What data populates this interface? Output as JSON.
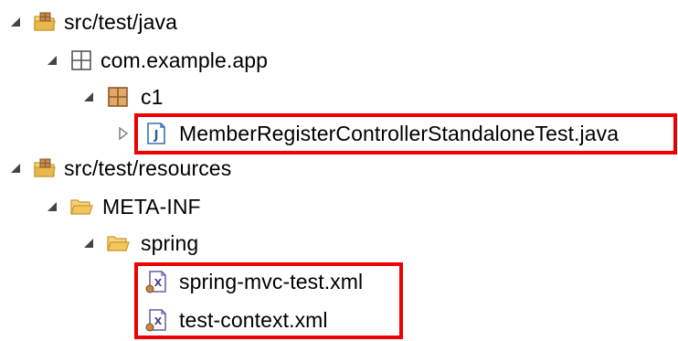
{
  "tree": {
    "items": [
      {
        "label": "src/test/java",
        "icon": "source-folder-icon",
        "state": "expanded"
      },
      {
        "label": "com.example.app",
        "icon": "package-empty-icon",
        "state": "expanded"
      },
      {
        "label": "c1",
        "icon": "package-icon",
        "state": "expanded"
      },
      {
        "label": "MemberRegisterControllerStandaloneTest.java",
        "icon": "java-file-icon",
        "state": "collapsed"
      },
      {
        "label": "src/test/resources",
        "icon": "source-folder-icon",
        "state": "expanded"
      },
      {
        "label": "META-INF",
        "icon": "folder-icon",
        "state": "expanded"
      },
      {
        "label": "spring",
        "icon": "folder-icon",
        "state": "expanded"
      },
      {
        "label": "spring-mvc-test.xml",
        "icon": "xml-file-icon",
        "state": "leaf"
      },
      {
        "label": "test-context.xml",
        "icon": "xml-file-icon",
        "state": "leaf"
      }
    ]
  },
  "colors": {
    "highlight": "#ee0000",
    "folder": "#e8b84a",
    "package": "#c3884a",
    "java_file": "#3a6fb0",
    "xml_file": "#6a5aa8",
    "twisty": "#444444"
  }
}
